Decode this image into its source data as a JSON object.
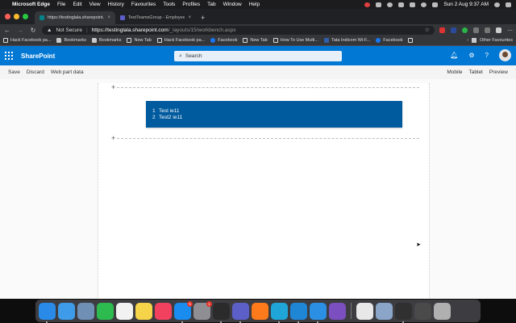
{
  "menubar": {
    "app_name": "Microsoft Edge",
    "menus": [
      "File",
      "Edit",
      "View",
      "History",
      "Favourites",
      "Tools",
      "Profiles",
      "Tab",
      "Window",
      "Help"
    ],
    "clock": "Sun 2 Aug  9:37 AM"
  },
  "tabs": [
    {
      "label": "https://testinglala.sharepoint.c",
      "active": true
    },
    {
      "label": "TestTeamsGroup - Employee",
      "active": false
    }
  ],
  "address": {
    "security": "Not Secure",
    "host": "https://testinglala.sharepoint.com",
    "path": "/_layouts/15/workbench.aspx"
  },
  "bookmarks": [
    {
      "label": "Hack Facebook pa...",
      "icon": "doc"
    },
    {
      "label": "Bookmarks",
      "icon": "folder"
    },
    {
      "label": "Bookmarks",
      "icon": "folder"
    },
    {
      "label": "New Tab",
      "icon": "doc"
    },
    {
      "label": "Hack Facebook pa...",
      "icon": "doc"
    },
    {
      "label": "Facebook",
      "icon": "fb"
    },
    {
      "label": "New Tab",
      "icon": "doc"
    },
    {
      "label": "How To Use Multi...",
      "icon": "doc"
    },
    {
      "label": "Tata Indicom Wi-F...",
      "icon": "tata"
    },
    {
      "label": "Facebook",
      "icon": "fb"
    }
  ],
  "bookmarks_other": "Other Favourites",
  "suitebar": {
    "title": "SharePoint",
    "search_placeholder": "Search"
  },
  "cmdbar": {
    "left": [
      "Save",
      "Discard",
      "Web part data"
    ],
    "right": [
      "Mobile",
      "Tablet",
      "Preview"
    ]
  },
  "webpart": {
    "items": [
      {
        "num": "1",
        "text": "Test ie11"
      },
      {
        "num": "2",
        "text": "Test2 ie11"
      }
    ]
  },
  "dock": {
    "apps": [
      {
        "name": "finder",
        "color": "#2a8ae8"
      },
      {
        "name": "safari",
        "color": "#3d9be9"
      },
      {
        "name": "preview",
        "color": "#6f8fb5"
      },
      {
        "name": "facetime",
        "color": "#2dbb4f"
      },
      {
        "name": "calendar",
        "color": "#f2f2f2"
      },
      {
        "name": "notes",
        "color": "#f6d44a"
      },
      {
        "name": "music",
        "color": "#f2415e"
      },
      {
        "name": "app-store",
        "color": "#1a8cf0",
        "badge": "5"
      },
      {
        "name": "system-preferences",
        "color": "#8e8e93",
        "badge": "1"
      },
      {
        "name": "terminal",
        "color": "#2b2b2b"
      },
      {
        "name": "teams",
        "color": "#5b5fc7"
      },
      {
        "name": "firefox",
        "color": "#ff7a1a"
      },
      {
        "name": "edge",
        "color": "#1fa5d8"
      },
      {
        "name": "vscode",
        "color": "#1f86d6"
      },
      {
        "name": "azure-storage",
        "color": "#2b8fe3"
      },
      {
        "name": "visual-studio",
        "color": "#7b4fbf"
      }
    ],
    "right_apps": [
      {
        "name": "textedit",
        "color": "#e8e8e8"
      },
      {
        "name": "photo",
        "color": "#8aa5c8"
      },
      {
        "name": "obs",
        "color": "#303030"
      },
      {
        "name": "folder-stack",
        "color": "#4a4a4a"
      },
      {
        "name": "trash",
        "color": "#b0b0b0"
      }
    ]
  }
}
